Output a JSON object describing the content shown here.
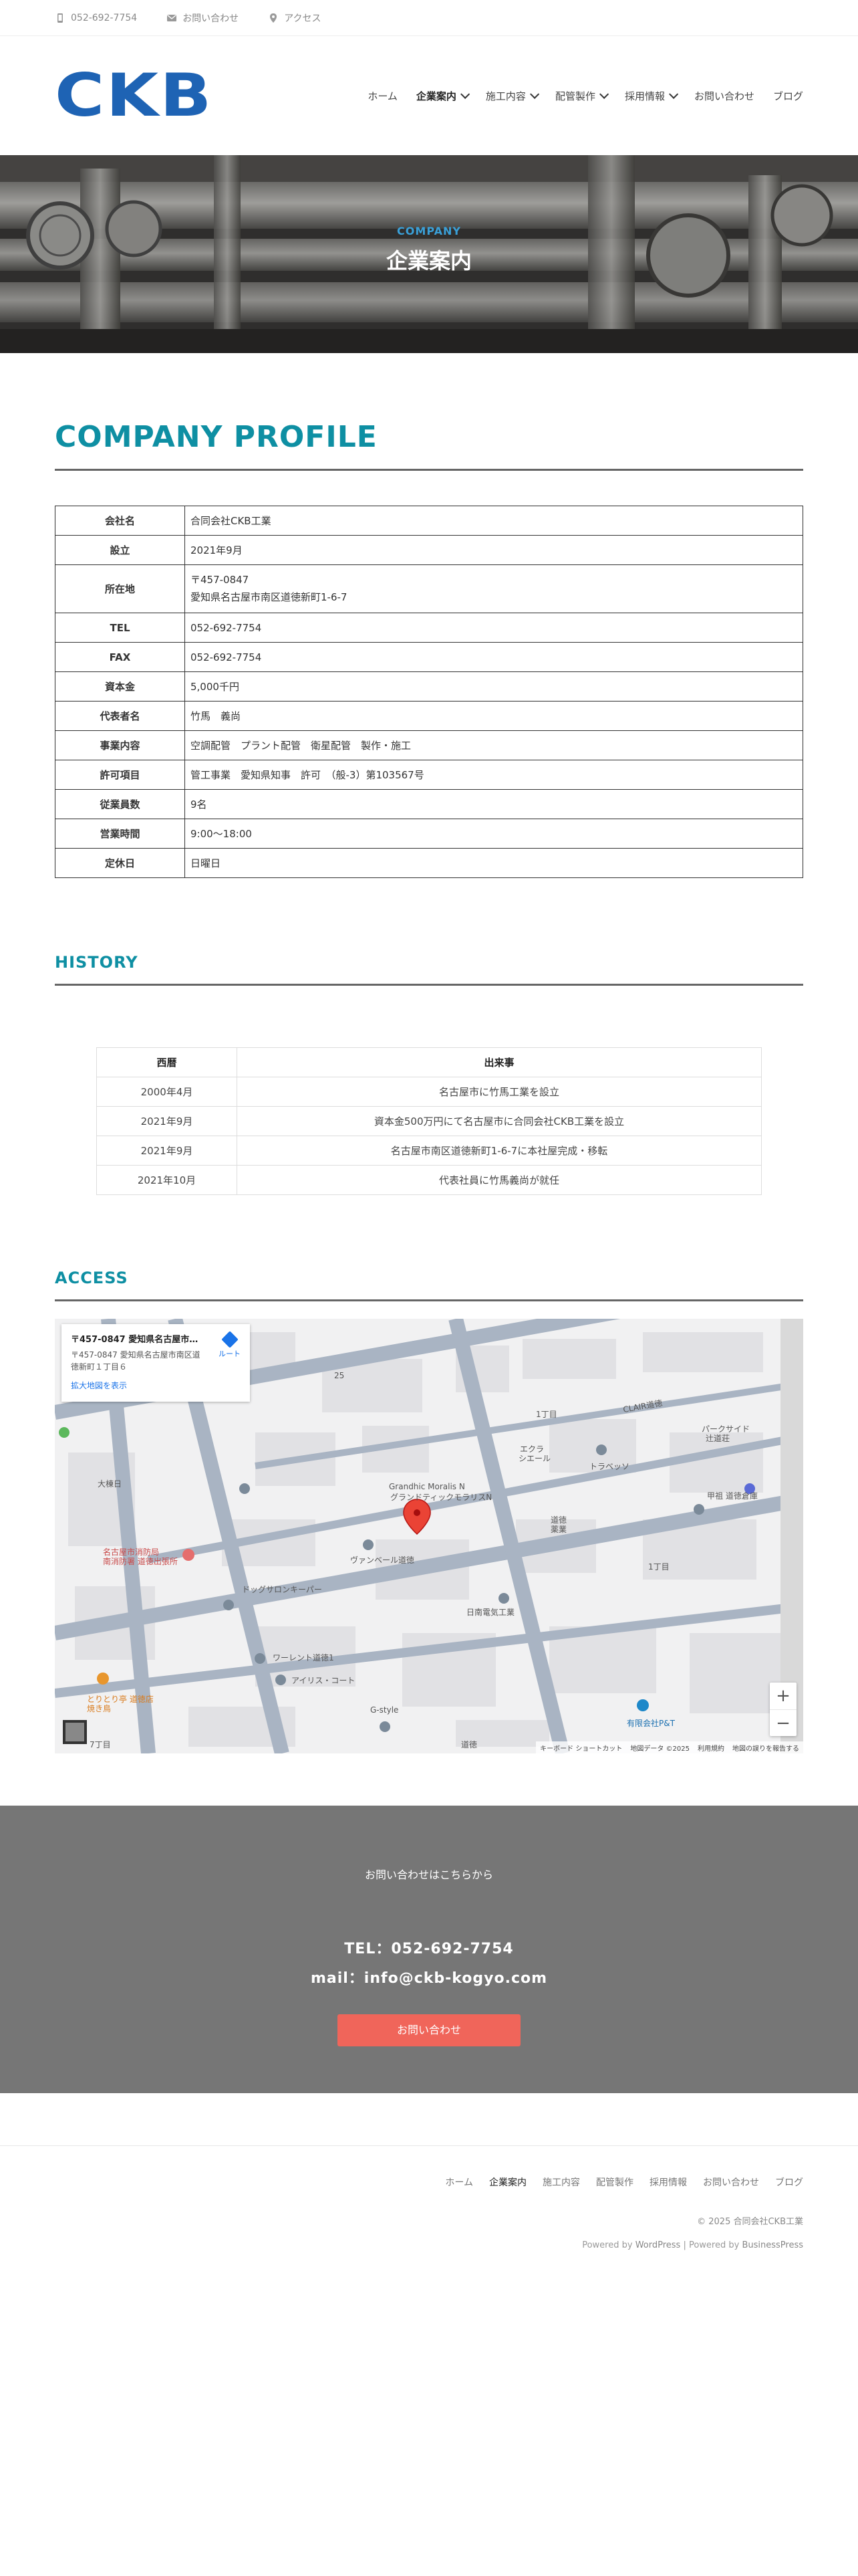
{
  "topbar": {
    "phone": "052-692-7754",
    "contact": "お問い合わせ",
    "access": "アクセス"
  },
  "header": {
    "logo": "CKB",
    "nav": [
      "ホーム",
      "企業案内",
      "施工内容",
      "配管製作",
      "採用情報",
      "お問い合わせ",
      "ブログ"
    ]
  },
  "hero": {
    "subtitle": "COMPANY",
    "title": "企業案内"
  },
  "profile": {
    "heading": "COMPANY PROFILE",
    "rows": [
      {
        "label": "会社名",
        "value": "合同会社CKB工業"
      },
      {
        "label": "設立",
        "value": "2021年9月"
      },
      {
        "label": "所在地",
        "value": "〒457-0847",
        "value2": "愛知県名古屋市南区道徳新町1-6-7"
      },
      {
        "label": "TEL",
        "value": "052-692-7754"
      },
      {
        "label": "FAX",
        "value": "052-692-7754"
      },
      {
        "label": "資本金",
        "value": "5,000千円"
      },
      {
        "label": "代表者名",
        "value": "竹馬　義尚"
      },
      {
        "label": "事業内容",
        "value": "空調配管　プラント配管　衛星配管　製作・施工"
      },
      {
        "label": "許可項目",
        "value": "管工事業　愛知県知事　許可　（般-3）第103567号"
      },
      {
        "label": "従業員数",
        "value": "9名"
      },
      {
        "label": "営業時間",
        "value": "9:00〜18:00"
      },
      {
        "label": "定休日",
        "value": "日曜日"
      }
    ]
  },
  "history": {
    "heading": "HISTORY",
    "col_year": "西暦",
    "col_event": "出来事",
    "rows": [
      {
        "year": "2000年4月",
        "event": "名古屋市に竹馬工業を設立"
      },
      {
        "year": "2021年9月",
        "event": "資本金500万円にて名古屋市に合同会社CKB工業を設立"
      },
      {
        "year": "2021年9月",
        "event": "名古屋市南区道徳新町1-6-7に本社屋完成・移転"
      },
      {
        "year": "2021年10月",
        "event": "代表社員に竹馬義尚が就任"
      }
    ]
  },
  "access": {
    "heading": "ACCESS",
    "card_title": "〒457-0847 愛知県名古屋市南...",
    "card_addr": "〒457-0847 愛知県名古屋市南区道徳新町１丁目６",
    "card_link": "拡大地図を表示",
    "route": "ルート",
    "zoom_in": "+",
    "zoom_out": "−",
    "footer": [
      "キーボード ショートカット",
      "地図データ ©2025",
      "利用規約",
      "地図の誤りを報告する"
    ],
    "labels": {
      "l1": "25",
      "l2": "1丁目",
      "l3": "CLAIR道徳",
      "l4": "パークサイド",
      "l4b": "辻道荘",
      "l5": "エクラ",
      "l5b": "シエール",
      "l6": "トラベッソ",
      "l7": "甲祖 道徳倉庫",
      "l8": "Grandhic Moralis N",
      "l8b": "グランドティックモラリスN",
      "l9": "道徳",
      "l9b": "薬業",
      "l10": "大棟日",
      "l11": "名古屋市消防局",
      "l11b": "南消防署 道徳出張所",
      "l12": "ヴァンベール道徳",
      "l13": "ドッグサロンキーパー",
      "l14": "日南電気工業",
      "l15": "1丁目",
      "l16": "ワーレント道徳1",
      "l17": "アイリス・コート",
      "l18": "とりとり亭 道徳店",
      "l18b": "焼き鳥",
      "l19": "G-style",
      "l20": "有限会社P&T",
      "l21": "7丁目",
      "l22": "道徳"
    }
  },
  "contact": {
    "lead": "お問い合わせはこちらから",
    "tel": "TEL：052-692-7754",
    "mail": "mail：info@ckb-kogyo.com",
    "button": "お問い合わせ"
  },
  "footer": {
    "nav": [
      "ホーム",
      "企業案内",
      "施工内容",
      "配管製作",
      "採用情報",
      "お問い合わせ",
      "ブログ"
    ],
    "copyright": "© 2025 合同会社CKB工業",
    "powered_prefix": "Powered by ",
    "wordpress": "WordPress",
    "sep": " | Powered by ",
    "bp": "BusinessPress"
  },
  "colors": {
    "accent": "#0e8fa3",
    "logo": "#1e63b4",
    "button": "#f0655a",
    "contact_bg": "#767676"
  }
}
